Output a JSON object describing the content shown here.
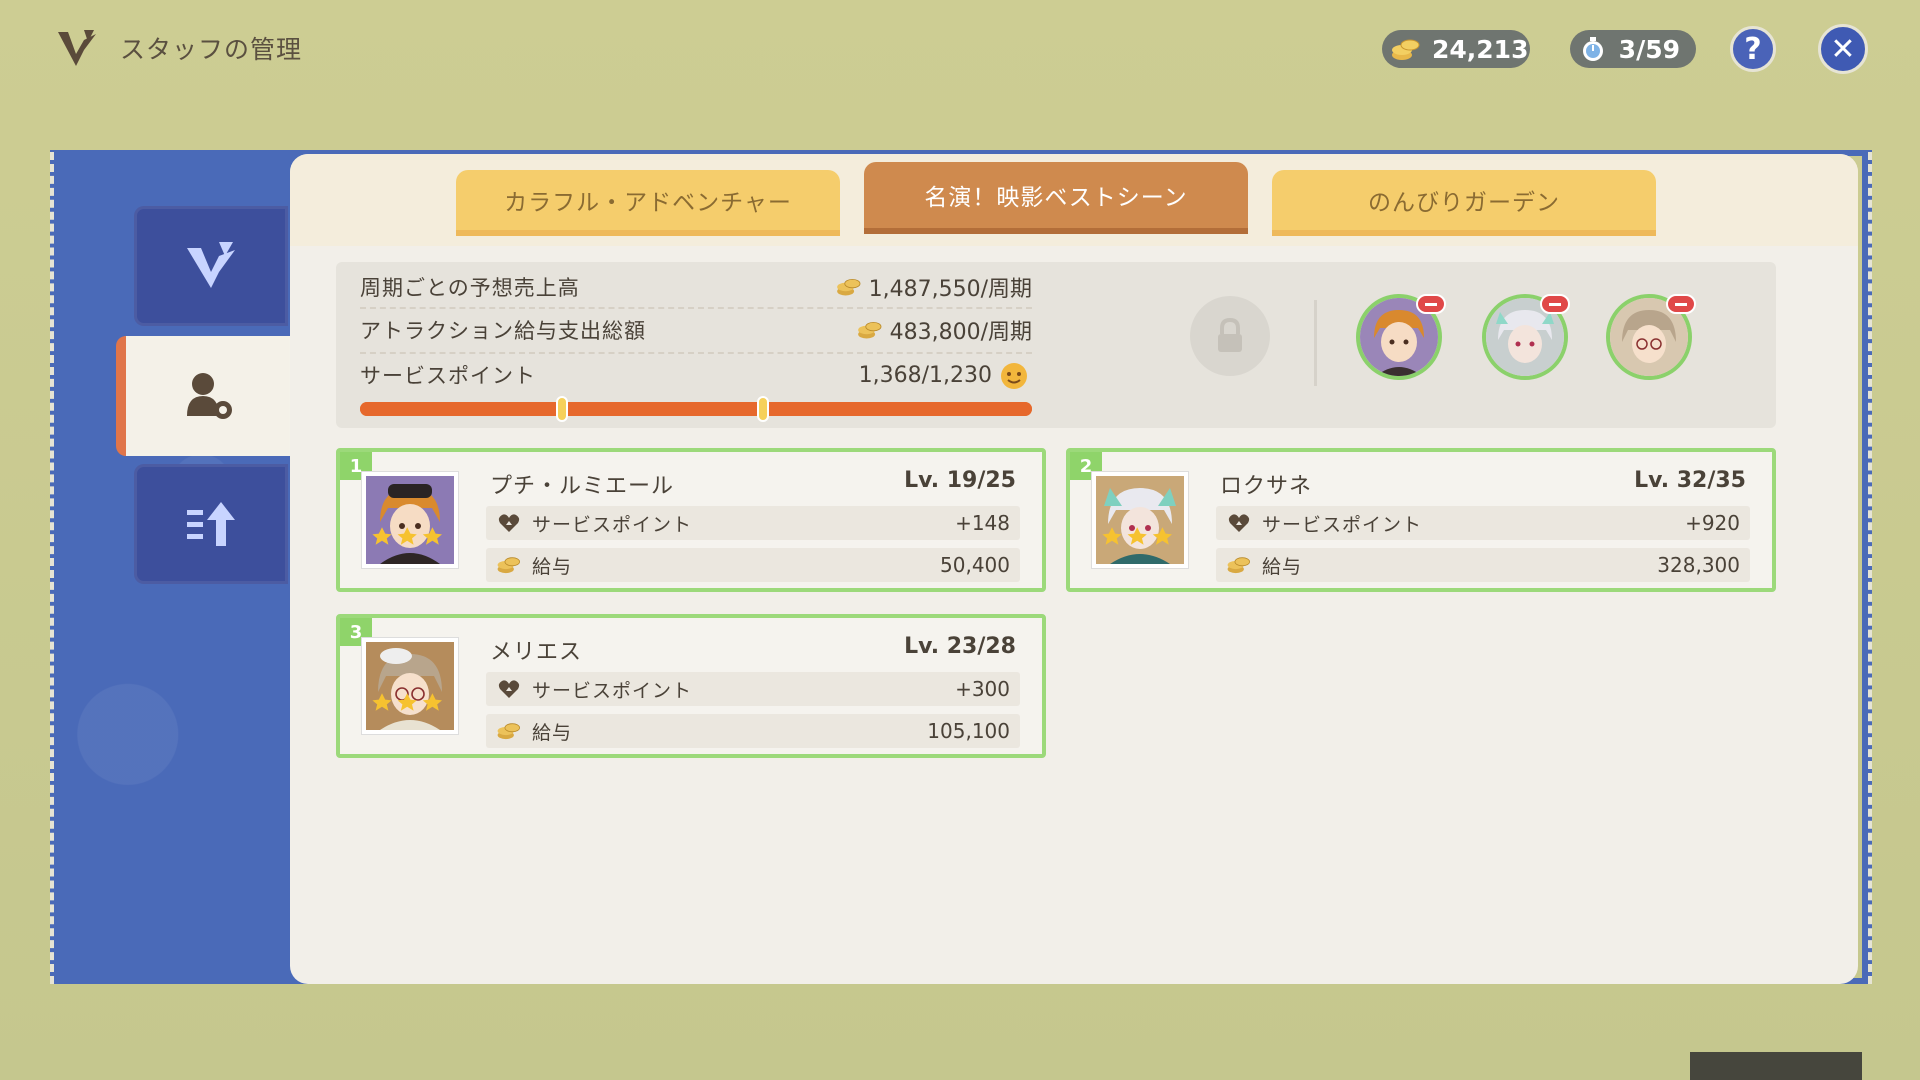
{
  "header": {
    "title": "スタッフの管理",
    "coins": "24,213",
    "timer": "3/59",
    "help_label": "?",
    "close_label": "✕"
  },
  "tabs": [
    {
      "label": "カラフル・アドベンチャー",
      "active": false
    },
    {
      "label": "名演！映影ベストシーン",
      "active": true
    },
    {
      "label": "のんびりガーデン",
      "active": false
    }
  ],
  "summary": {
    "revenue_label": "周期ごとの予想売上高",
    "revenue_value": "1,487,550/周期",
    "salary_label": "アトラクション給与支出総額",
    "salary_value": "483,800/周期",
    "service_label": "サービスポイント",
    "service_value": "1,368/1,230",
    "service_progress": 1.0,
    "marker_levels": [
      0.3,
      0.6
    ]
  },
  "staff": [
    {
      "index": "1",
      "name": "プチ・ルミエール",
      "level": "Lv. 19/25",
      "sp_label": "サービスポイント",
      "sp_value": "+148",
      "salary_label": "給与",
      "salary_value": "50,400"
    },
    {
      "index": "2",
      "name": "ロクサネ",
      "level": "Lv. 32/35",
      "sp_label": "サービスポイント",
      "sp_value": "+920",
      "salary_label": "給与",
      "salary_value": "328,300"
    },
    {
      "index": "3",
      "name": "メリエス",
      "level": "Lv. 23/28",
      "sp_label": "サービスポイント",
      "sp_value": "+300",
      "salary_label": "給与",
      "salary_value": "105,100"
    }
  ],
  "icons": {
    "coin": "coin-stack-icon",
    "timer": "stopwatch-icon",
    "heart": "heart-icon",
    "lock": "lock-icon"
  },
  "colors": {
    "accent_green": "#9cd97a",
    "tab_active": "#cf8a4e",
    "tab_inactive": "#f5cd6c",
    "frame_blue": "#4a6ab8",
    "bar_orange": "#e6682c"
  }
}
